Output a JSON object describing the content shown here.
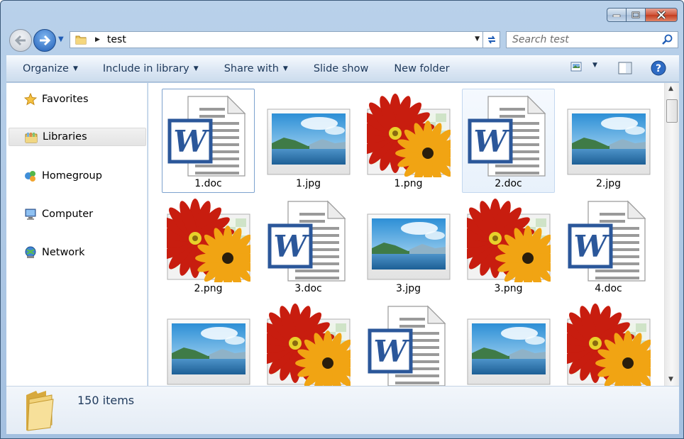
{
  "window": {
    "minimize_label": "minimize",
    "maximize_label": "maximize",
    "close_label": "close"
  },
  "address_bar": {
    "path": "test",
    "search_placeholder": "Search test"
  },
  "toolbar": {
    "organize": "Organize",
    "include_in_library": "Include in library",
    "share_with": "Share with",
    "slide_show": "Slide show",
    "new_folder": "New folder"
  },
  "navigation": {
    "items": [
      {
        "label": "Favorites",
        "icon": "star-icon"
      },
      {
        "label": "Libraries",
        "icon": "libraries-icon"
      },
      {
        "label": "Homegroup",
        "icon": "homegroup-icon"
      },
      {
        "label": "Computer",
        "icon": "computer-icon"
      },
      {
        "label": "Network",
        "icon": "network-icon"
      }
    ],
    "selected": "Libraries"
  },
  "files": [
    {
      "name": "1.doc",
      "kind": "doc"
    },
    {
      "name": "1.jpg",
      "kind": "jpg"
    },
    {
      "name": "1.png",
      "kind": "png"
    },
    {
      "name": "2.doc",
      "kind": "doc"
    },
    {
      "name": "2.jpg",
      "kind": "jpg"
    },
    {
      "name": "2.png",
      "kind": "png"
    },
    {
      "name": "3.doc",
      "kind": "doc"
    },
    {
      "name": "3.jpg",
      "kind": "jpg"
    },
    {
      "name": "3.png",
      "kind": "png"
    },
    {
      "name": "4.doc",
      "kind": "doc"
    },
    {
      "name": "",
      "kind": "jpg"
    },
    {
      "name": "",
      "kind": "png"
    },
    {
      "name": "",
      "kind": "doc"
    },
    {
      "name": "",
      "kind": "jpg"
    },
    {
      "name": "",
      "kind": "png"
    }
  ],
  "status": {
    "item_count": "150 items"
  },
  "colors": {
    "accent": "#1f5db6",
    "word_blue": "#2b579a",
    "close_red": "#c23c1f"
  }
}
